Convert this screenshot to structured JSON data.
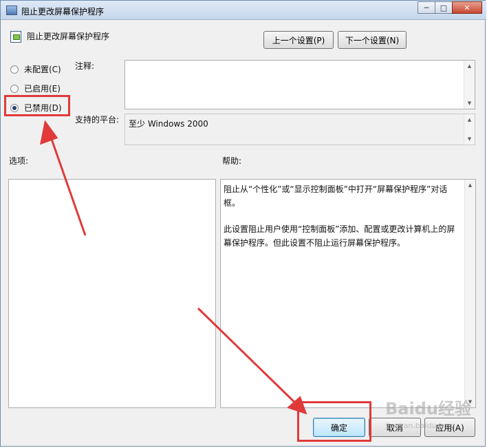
{
  "window": {
    "title": "阻止更改屏幕保护程序"
  },
  "caption": {
    "minimize": "─",
    "maximize": "□",
    "close": "✕"
  },
  "policy": {
    "title": "阻止更改屏幕保护程序"
  },
  "nav": {
    "prev_label": "上一个设置(P)",
    "next_label": "下一个设置(N)"
  },
  "state": {
    "options": [
      {
        "label": "未配置(C)",
        "checked": false
      },
      {
        "label": "已启用(E)",
        "checked": false
      },
      {
        "label": "已禁用(D)",
        "checked": true
      }
    ]
  },
  "comment": {
    "label": "注释:",
    "value": ""
  },
  "platform": {
    "label": "支持的平台:",
    "value": "至少 Windows 2000"
  },
  "options_section": {
    "label": "选项:"
  },
  "help": {
    "label": "帮助:",
    "paragraphs": [
      "阻止从“个性化”或“显示控制面板”中打开“屏幕保护程序”对话框。",
      "此设置阻止用户使用“控制面板”添加、配置或更改计算机上的屏幕保护程序。但此设置不阻止运行屏幕保护程序。"
    ]
  },
  "footer": {
    "ok_label": "确定",
    "cancel_label": "取消",
    "apply_label": "应用(A)"
  },
  "watermark": {
    "text": "Baidu经验",
    "sub": "jingyan.baidu.com"
  },
  "colors": {
    "annotation": "#e03a3a",
    "titlebar": "#c6d7ec",
    "dialog_bg": "#f0f0f0"
  }
}
